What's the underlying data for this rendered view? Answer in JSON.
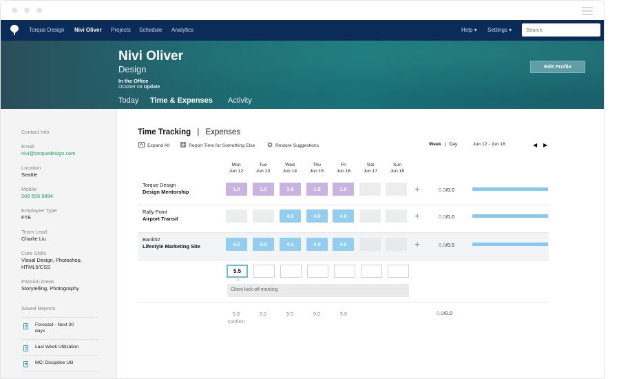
{
  "nav": {
    "links": [
      "Torque Design",
      "Nivi Oliver",
      "Projects",
      "Schedule",
      "Analytics"
    ],
    "help": "Help ▾",
    "settings": "Settings ▾",
    "search_placeholder": "Search"
  },
  "profile": {
    "name": "Nivi Oliver",
    "department": "Design",
    "status": "In the Office",
    "update_date": "October 04",
    "update_label": "Update",
    "edit_button": "Edit Profile",
    "tabs": [
      "Today",
      "Time & Expenses",
      "Activity"
    ]
  },
  "sidebar": {
    "contact_info": "Contact Info",
    "email_label": "Email",
    "email": "nivi@torquedesign.com",
    "location_label": "Location",
    "location": "Seattle",
    "mobile_label": "Mobile",
    "mobile": "206 555 9894",
    "employee_type_label": "Employee Type",
    "employee_type": "FTE",
    "team_lead_label": "Team Lead",
    "team_lead": "Charlie Liu",
    "core_skills_label": "Core Skills",
    "core_skills_1": "Visual Design, Photoshop,",
    "core_skills_2": "HTML5/CSS",
    "passion_label": "Passion Areas",
    "passion": "Storytelling, Photography",
    "saved_reports_label": "Saved Reports",
    "reports": [
      {
        "line1": "Forecast - Next 30",
        "line2": "days"
      },
      {
        "line1": "Last Week Utilization",
        "line2": ""
      },
      {
        "line1": "MCI Discipline Util",
        "line2": ""
      }
    ]
  },
  "main": {
    "title": "Time Tracking",
    "separator": "|",
    "expenses_tab": "Expenses",
    "toolbar": {
      "expand_all": "Expand All",
      "report_time": "Report Time for Something Else",
      "restore": "Restore Suggestions"
    },
    "view_week": "Week",
    "view_sep": "|",
    "view_day": "Day",
    "date_range": "Jun 12 - Jun 18",
    "prev_arrow": "◀",
    "next_arrow": "▶",
    "days": [
      {
        "dow": "Mon",
        "date": "Jun 12"
      },
      {
        "dow": "Tue",
        "date": "Jun 13"
      },
      {
        "dow": "Wed",
        "date": "Jun 14"
      },
      {
        "dow": "Thu",
        "date": "Jun 15"
      },
      {
        "dow": "Fri",
        "date": "Jun 16"
      },
      {
        "dow": "Sat",
        "date": "Jun 17"
      },
      {
        "dow": "Sun",
        "date": "Jun 18"
      }
    ],
    "rows": [
      {
        "client": "Torque Design",
        "project": "Design Mentorship",
        "cells": [
          "1.0",
          "1.0",
          "1.0",
          "1.0",
          "1.0",
          "",
          ""
        ],
        "total_done": "0.0",
        "total_planned": "/0.0"
      },
      {
        "client": "Rally Point",
        "project": "Airport Transit",
        "cells": [
          "",
          "",
          "4.0",
          "4.0",
          "4.0",
          "",
          ""
        ],
        "total_done": "0.0",
        "total_planned": "/0.0"
      },
      {
        "client": "Bank52",
        "project": "Lifestyle Marketing Site",
        "cells": [
          "4.0",
          "4.0",
          "4.0",
          "4.0",
          "4.0",
          "",
          ""
        ],
        "total_done": "0.0",
        "total_planned": "/0.0"
      }
    ],
    "entry_value": "5.5",
    "entry_note_placeholder": "Client kick-off meeting",
    "footer_totals": [
      "5.0",
      "5.0",
      "9.0",
      "9.0",
      "9.0"
    ],
    "footer_confirm": "confirm",
    "footer_total_done": "0.0",
    "footer_total_planned": "/0.0"
  },
  "colors": {
    "nav": "#0b2b58",
    "link_green": "#19a35b",
    "cell_purple": "#c8b3e1",
    "cell_blue": "#93cdf0",
    "progress_blue": "#86c9ee"
  }
}
